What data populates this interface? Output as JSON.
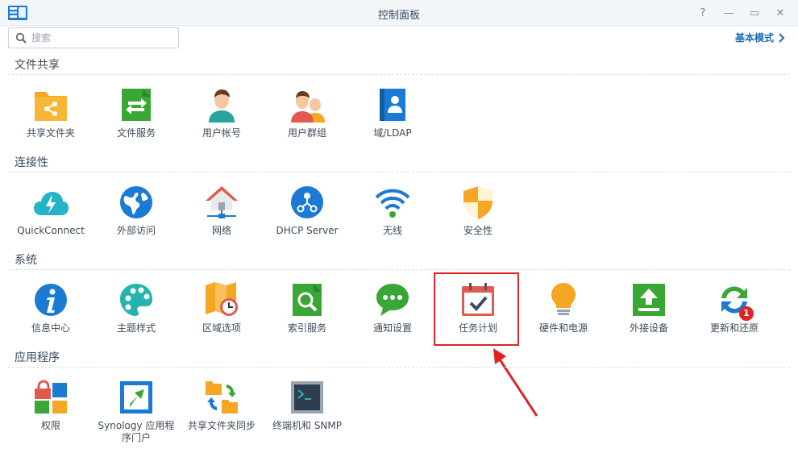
{
  "window": {
    "title": "控制面板",
    "help": "?",
    "minimize": "—",
    "maximize": "▭",
    "close": "✕"
  },
  "search": {
    "placeholder": "搜索"
  },
  "mode_link": {
    "label": "基本模式"
  },
  "sections": [
    {
      "title": "文件共享",
      "items": [
        {
          "label": "共享文件夹",
          "icon": "shared-folder-icon"
        },
        {
          "label": "文件服务",
          "icon": "file-services-icon"
        },
        {
          "label": "用户帐号",
          "icon": "user-icon"
        },
        {
          "label": "用户群组",
          "icon": "group-icon"
        },
        {
          "label": "域/LDAP",
          "icon": "domain-ldap-icon"
        }
      ]
    },
    {
      "title": "连接性",
      "items": [
        {
          "label": "QuickConnect",
          "icon": "quickconnect-icon"
        },
        {
          "label": "外部访问",
          "icon": "globe-icon"
        },
        {
          "label": "网络",
          "icon": "network-house-icon"
        },
        {
          "label": "DHCP Server",
          "icon": "dhcp-icon"
        },
        {
          "label": "无线",
          "icon": "wifi-icon"
        },
        {
          "label": "安全性",
          "icon": "shield-icon"
        }
      ]
    },
    {
      "title": "系统",
      "items": [
        {
          "label": "信息中心",
          "icon": "info-icon"
        },
        {
          "label": "主题样式",
          "icon": "palette-icon"
        },
        {
          "label": "区域选项",
          "icon": "map-clock-icon"
        },
        {
          "label": "索引服务",
          "icon": "index-search-icon"
        },
        {
          "label": "通知设置",
          "icon": "chat-bubble-icon"
        },
        {
          "label": "任务计划",
          "icon": "calendar-check-icon"
        },
        {
          "label": "硬件和电源",
          "icon": "lightbulb-icon"
        },
        {
          "label": "外接设备",
          "icon": "upload-device-icon"
        },
        {
          "label": "更新和还原",
          "icon": "refresh-icon",
          "badge": "1"
        }
      ]
    },
    {
      "title": "应用程序",
      "items": [
        {
          "label": "权限",
          "icon": "permissions-icon"
        },
        {
          "label": "Synology 应用程序门户",
          "line1": "Synology 应用程",
          "line2": "序门户",
          "icon": "portal-arrow-icon"
        },
        {
          "label": "共享文件夹同步",
          "icon": "folder-sync-icon"
        },
        {
          "label": "终端机和 SNMP",
          "icon": "terminal-icon"
        }
      ]
    }
  ],
  "colors": {
    "accent": "#1f6bb5",
    "highlight": "#e02222",
    "orange": "#f5a623",
    "green": "#3aa635",
    "blue": "#1a7ad4"
  }
}
